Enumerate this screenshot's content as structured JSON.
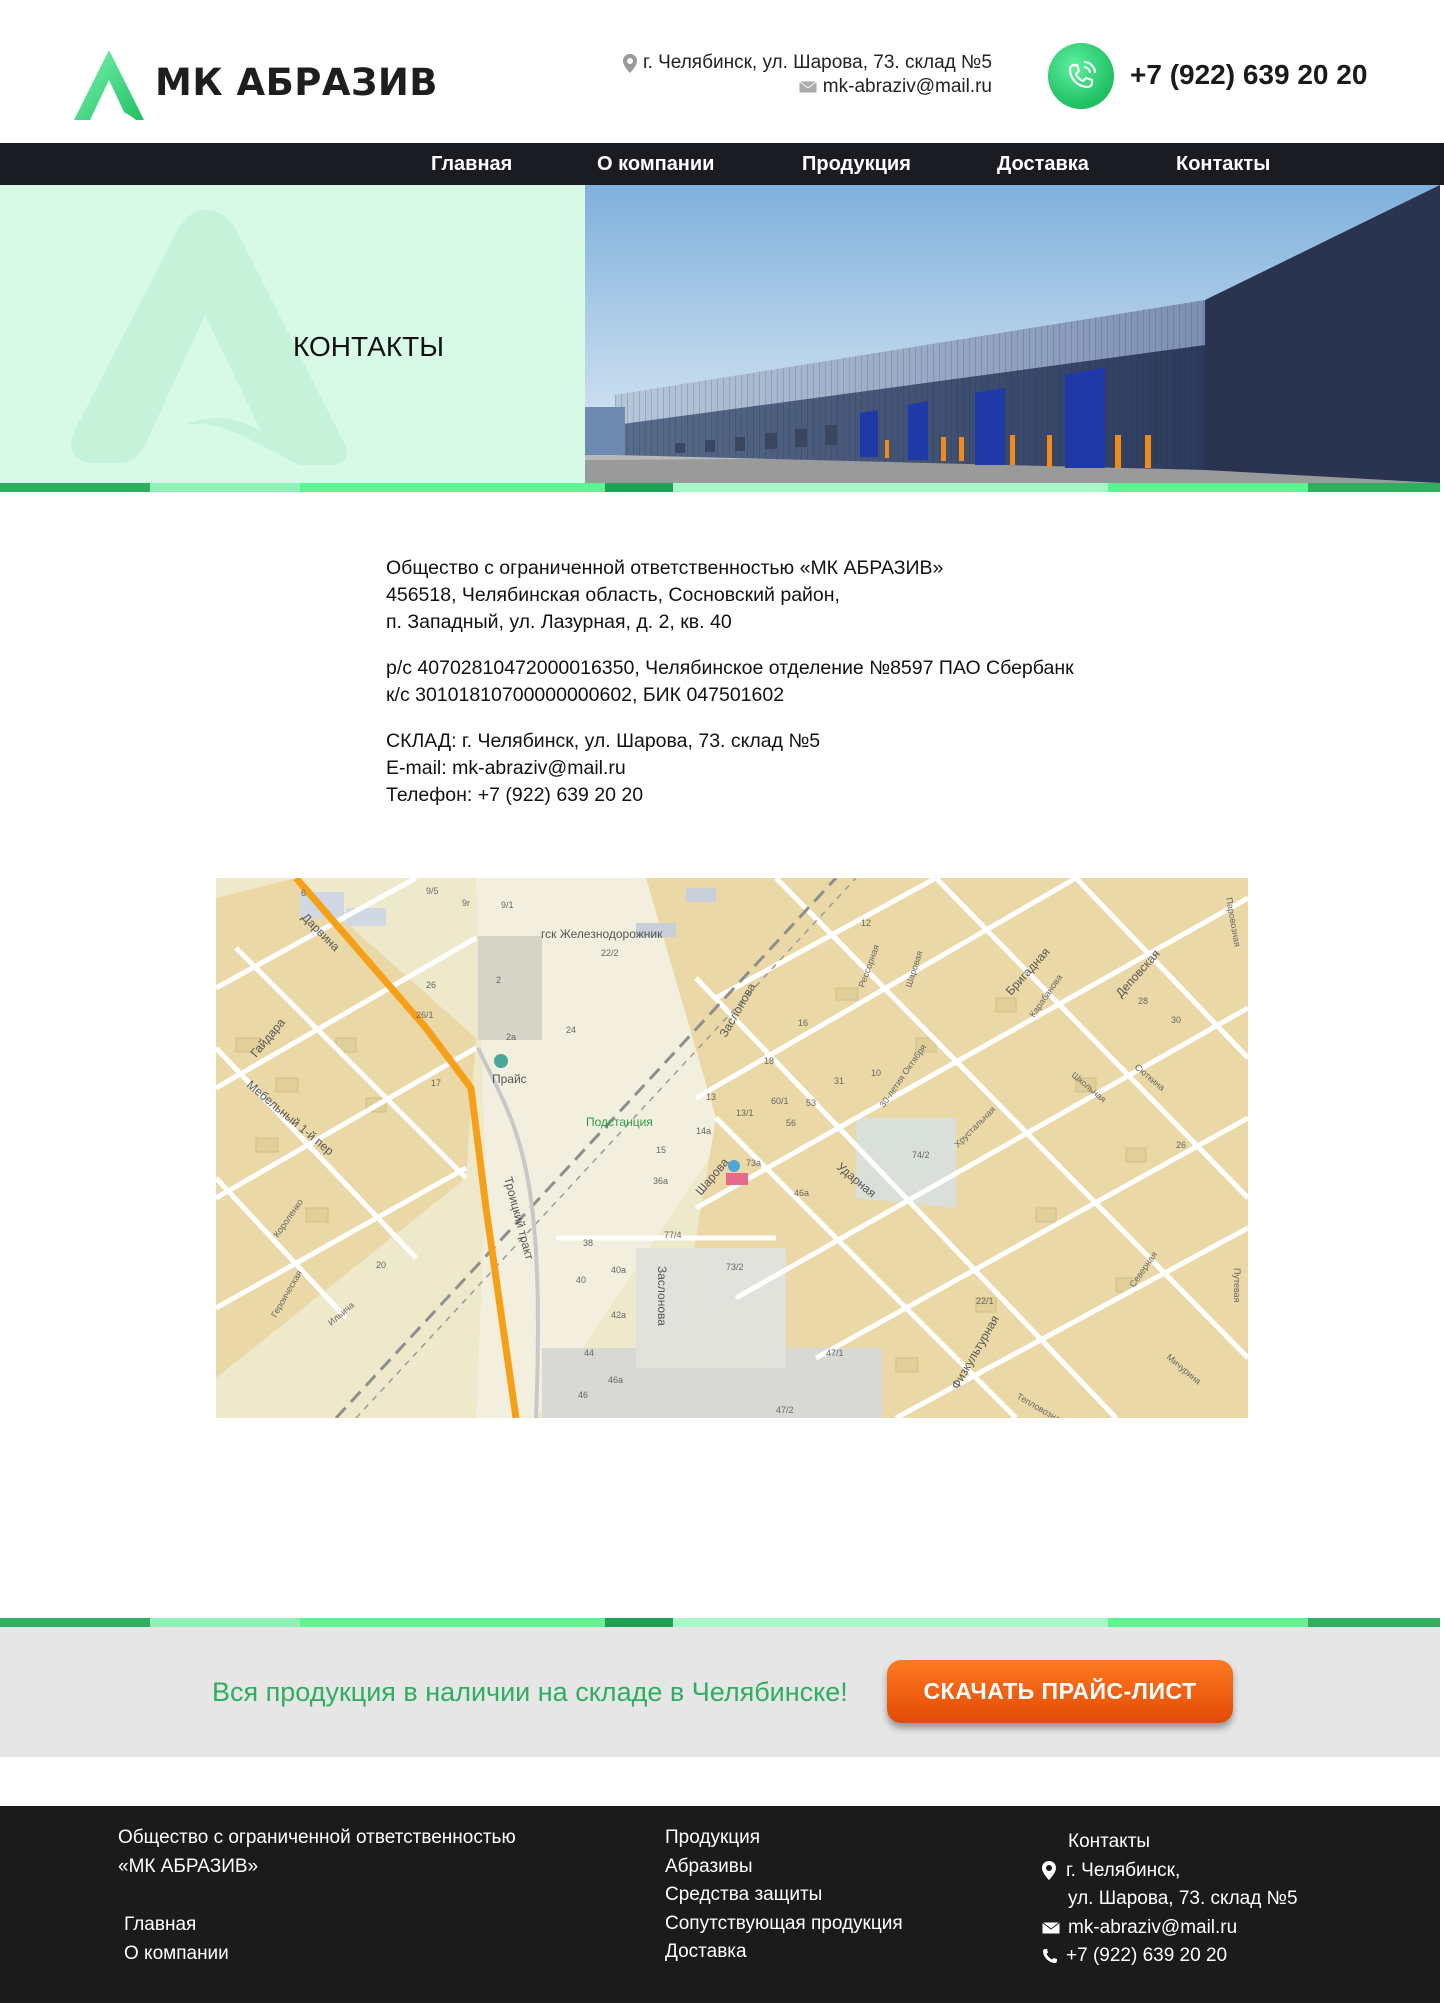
{
  "header": {
    "logo_text": "МК АБРАЗИВ",
    "address": "г. Челябинск, ул. Шарова, 73. склад №5",
    "email": "mk-abraziv@mail.ru",
    "phone": "+7 (922) 639 20 20"
  },
  "nav": {
    "items": [
      {
        "label": "Главная"
      },
      {
        "label": "О компании"
      },
      {
        "label": "Продукция"
      },
      {
        "label": "Доставка"
      },
      {
        "label": "Контакты"
      }
    ]
  },
  "hero": {
    "title": "КОНТАКТЫ"
  },
  "info": {
    "company_line1": "Общество с ограниченной ответственностью «МК АБРАЗИВ»",
    "company_line2": "456518, Челябинская область, Сосновский район,",
    "company_line3": "п. Западный, ул. Лазурная, д. 2, кв. 40",
    "bank_line1": "р/с 40702810472000016350, Челябинское отделение №8597 ПАО Сбербанк",
    "bank_line2": "к/с 30101810700000000602, БИК 047501602",
    "warehouse": "СКЛАД: г. Челябинск, ул. Шарова, 73. склад №5",
    "email": "E-mail: mk-abraziv@mail.ru",
    "phone": "Телефон: +7 (922) 639 20 20"
  },
  "map": {
    "labels": {
      "darvina": "Дарвина",
      "gaidara": "Гайдара",
      "mebelny": "Мебельный 1-й пер",
      "troitsky": "Троицкий тракт",
      "zheleznodorozhnik": "гск Железнодорожник",
      "zaslonova": "Заслонова",
      "zaslonova2": "Заслонова",
      "sharova": "Шарова",
      "udarnaya": "Ударная",
      "brigadnaya": "Бригадная",
      "depovskaya": "Деповская",
      "fizkulturnaya": "Физкультурная",
      "podstantsiya": "Подстанция",
      "price": "Прайс",
      "rassornaya": "Рессорная",
      "oktyabrya": "30-летия Октября",
      "khrustalnaya": "Хрустальная",
      "korolenko": "Короленко",
      "ilyicha": "Ильича",
      "shkolnaya": "Школьная",
      "syutkina": "Сюткина",
      "severnaya": "Северная",
      "putevaya": "Путевая",
      "michurina": "Мичурина",
      "sharovskaya": "Шаровая",
      "karabanova": "Карабанова",
      "teplovoznaya": "Тепловозная",
      "parovoznaya": "Паровозная",
      "gerodcheskaya": "Героическая",
      "n2": "2",
      "n2a": "2a",
      "n26": "26",
      "n26_1": "26/1",
      "n24": "24",
      "n22_2": "22/2",
      "n9_5": "9/5",
      "n9g": "9г",
      "n9_1": "9/1",
      "n17": "17",
      "n12": "12",
      "n16": "16",
      "n18": "18",
      "n13": "13",
      "n13_1": "13/1",
      "n14a": "14a",
      "n15": "15",
      "n36a": "36a",
      "n60_1": "60/1",
      "n53": "53",
      "n56": "56",
      "n10": "10",
      "n73a": "73a",
      "n46a": "46a",
      "n77_4": "77/4",
      "n73_2": "73/2",
      "n38": "38",
      "n40a": "40a",
      "n40": "40",
      "n42a": "42a",
      "n44": "44",
      "n46": "46",
      "n46a2": "46a",
      "n47_1": "47/1",
      "n47_2": "47/2",
      "n22_1": "22/1",
      "n28": "28",
      "n30": "30",
      "n26b": "26",
      "n20": "20",
      "n74_2": "74/2",
      "n6": "6",
      "n31": "31"
    }
  },
  "promo": {
    "text": "Вся продукция в наличии на складе в Челябинске!",
    "button": "СКАЧАТЬ ПРАЙС-ЛИСТ"
  },
  "footer": {
    "company_line1": "Общество с ограниченной ответственностью",
    "company_line2": "«МК АБРАЗИВ»",
    "links_left": [
      "Главная",
      "О компании"
    ],
    "links_mid": [
      "Продукция",
      "Абразивы",
      "Средства защиты",
      "Сопутствующая продукция",
      "Доставка"
    ],
    "contacts_title": "Контакты",
    "address_line1": "г. Челябинск,",
    "address_line2": "ул. Шарова, 73. склад №5",
    "email": "mk-abraziv@mail.ru",
    "phone": "+7 (922) 639 20 20"
  },
  "colors": {
    "accent_green": "#2fae5f",
    "nav_bg": "#1a1c22",
    "button_orange": "#ef5f10",
    "footer_bg": "#1b1b1b"
  }
}
